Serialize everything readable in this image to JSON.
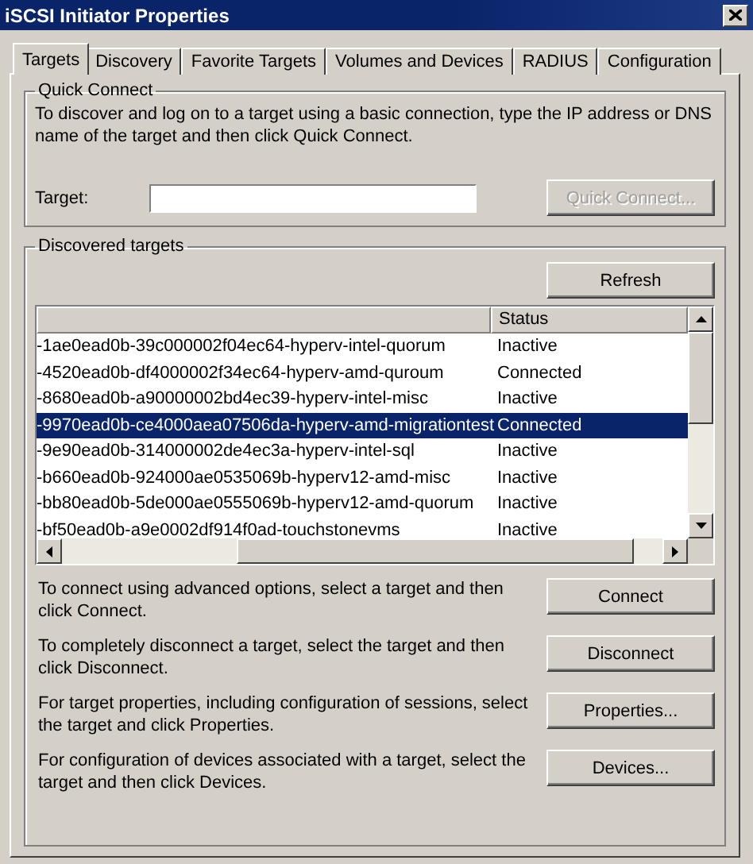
{
  "window": {
    "title": "iSCSI Initiator Properties"
  },
  "tabs": [
    {
      "label": "Targets",
      "selected": true
    },
    {
      "label": "Discovery",
      "selected": false
    },
    {
      "label": "Favorite Targets",
      "selected": false
    },
    {
      "label": "Volumes and Devices",
      "selected": false
    },
    {
      "label": "RADIUS",
      "selected": false
    },
    {
      "label": "Configuration",
      "selected": false
    }
  ],
  "quick_connect": {
    "title": "Quick Connect",
    "description": "To discover and log on to a target using a basic connection, type the IP address or DNS name of the target and then click Quick Connect.",
    "target_label": "Target:",
    "button": {
      "label": "Quick Connect...",
      "disabled": true
    }
  },
  "discovered_targets": {
    "title": "Discovered targets",
    "refresh_button": "Refresh",
    "status_column": "Status",
    "rows": [
      {
        "name": "-1ae0ead0b-39c000002f04ec64-hyperv-intel-quorum",
        "status": "Inactive",
        "selected": false
      },
      {
        "name": "-4520ead0b-df4000002f34ec64-hyperv-amd-quroum",
        "status": "Connected",
        "selected": false
      },
      {
        "name": "-8680ead0b-a90000002bd4ec39-hyperv-intel-misc",
        "status": "Inactive",
        "selected": false
      },
      {
        "name": "-9970ead0b-ce4000aea07506da-hyperv-amd-migrationtest",
        "status": "Connected",
        "selected": true
      },
      {
        "name": "-9e90ead0b-314000002de4ec3a-hyperv-intel-sql",
        "status": "Inactive",
        "selected": false
      },
      {
        "name": "-b660ead0b-924000ae0535069b-hyperv12-amd-misc",
        "status": "Inactive",
        "selected": false
      },
      {
        "name": "-bb80ead0b-5de000ae0555069b-hyperv12-amd-quorum",
        "status": "Inactive",
        "selected": false
      },
      {
        "name": "-bf50ead0b-a9e0002df914f0ad-touchstonevms",
        "status": "Inactive",
        "selected": false
      }
    ],
    "actions": [
      {
        "description": "To connect using advanced options, select a target and then click Connect.",
        "button": "Connect"
      },
      {
        "description": "To completely disconnect a target, select the target and then click Disconnect.",
        "button": "Disconnect"
      },
      {
        "description": "For target properties, including configuration of sessions, select the target and click Properties.",
        "button": "Properties..."
      },
      {
        "description": "For configuration of devices associated with a target, select the target and then click Devices.",
        "button": "Devices..."
      }
    ]
  }
}
